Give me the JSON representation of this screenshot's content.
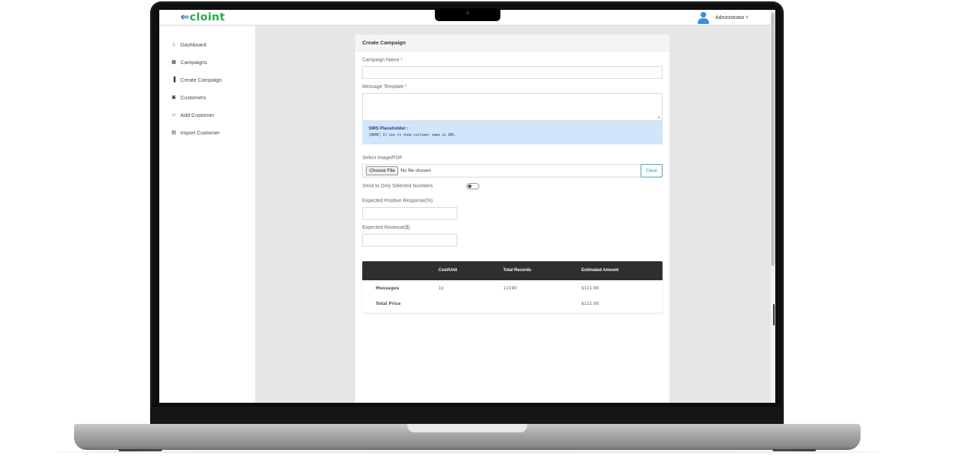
{
  "app": {
    "logo_prefix": "C",
    "logo_text": "cloint",
    "user_name": "Administrator ˅"
  },
  "sidebar": {
    "items": [
      {
        "label": "Dashboard",
        "icon": "home-icon",
        "glyph": "⌂"
      },
      {
        "label": "Campaigns",
        "icon": "table-icon",
        "glyph": "▦"
      },
      {
        "label": "Create Campaign",
        "icon": "bar-chart-icon",
        "glyph": "▐"
      },
      {
        "label": "Customers",
        "icon": "address-book-icon",
        "glyph": "▣"
      },
      {
        "label": "Add Customer",
        "icon": "user-plus-icon",
        "glyph": "☺"
      },
      {
        "label": "Import Customer",
        "icon": "file-import-icon",
        "glyph": "▤"
      }
    ]
  },
  "form": {
    "title": "Create Campaign",
    "campaign_name_label": "Campaign Name",
    "campaign_name_value": "",
    "message_template_label": "Message Template",
    "message_template_value": "",
    "required_mark": "*",
    "sms_placeholder_title": "SMS Placeholder :",
    "sms_placeholder_text": "[NAME] It use to show customer name in SMS.",
    "image_label": "Select Image/PDF",
    "choose_file_label": "Choose File",
    "file_status": "No file chosen",
    "clear_label": "Clear",
    "send_selected_label": "Send to Only Selected Numbers",
    "send_selected_enabled": false,
    "positive_response_label": "Expected Positive Response(%)",
    "positive_response_value": "",
    "revenue_label": "Expected Revenue($)",
    "revenue_value": ""
  },
  "pricing_table": {
    "headers": [
      "",
      "Cost/Unit",
      "Total Records",
      "Estimated Amount"
    ],
    "rows": [
      {
        "label": "Messages",
        "cost_unit": "1¢",
        "total_records": "11190",
        "estimated_amount": "$111.90"
      },
      {
        "label": "Total Price",
        "cost_unit": "",
        "total_records": "",
        "estimated_amount": "$111.90"
      }
    ]
  },
  "colors": {
    "brand_green": "#2aa84a",
    "brand_blue": "#2a64b8",
    "info_bg": "#cfe6fb",
    "table_header": "#2f2f2f",
    "clear_accent": "#37a3b0"
  }
}
